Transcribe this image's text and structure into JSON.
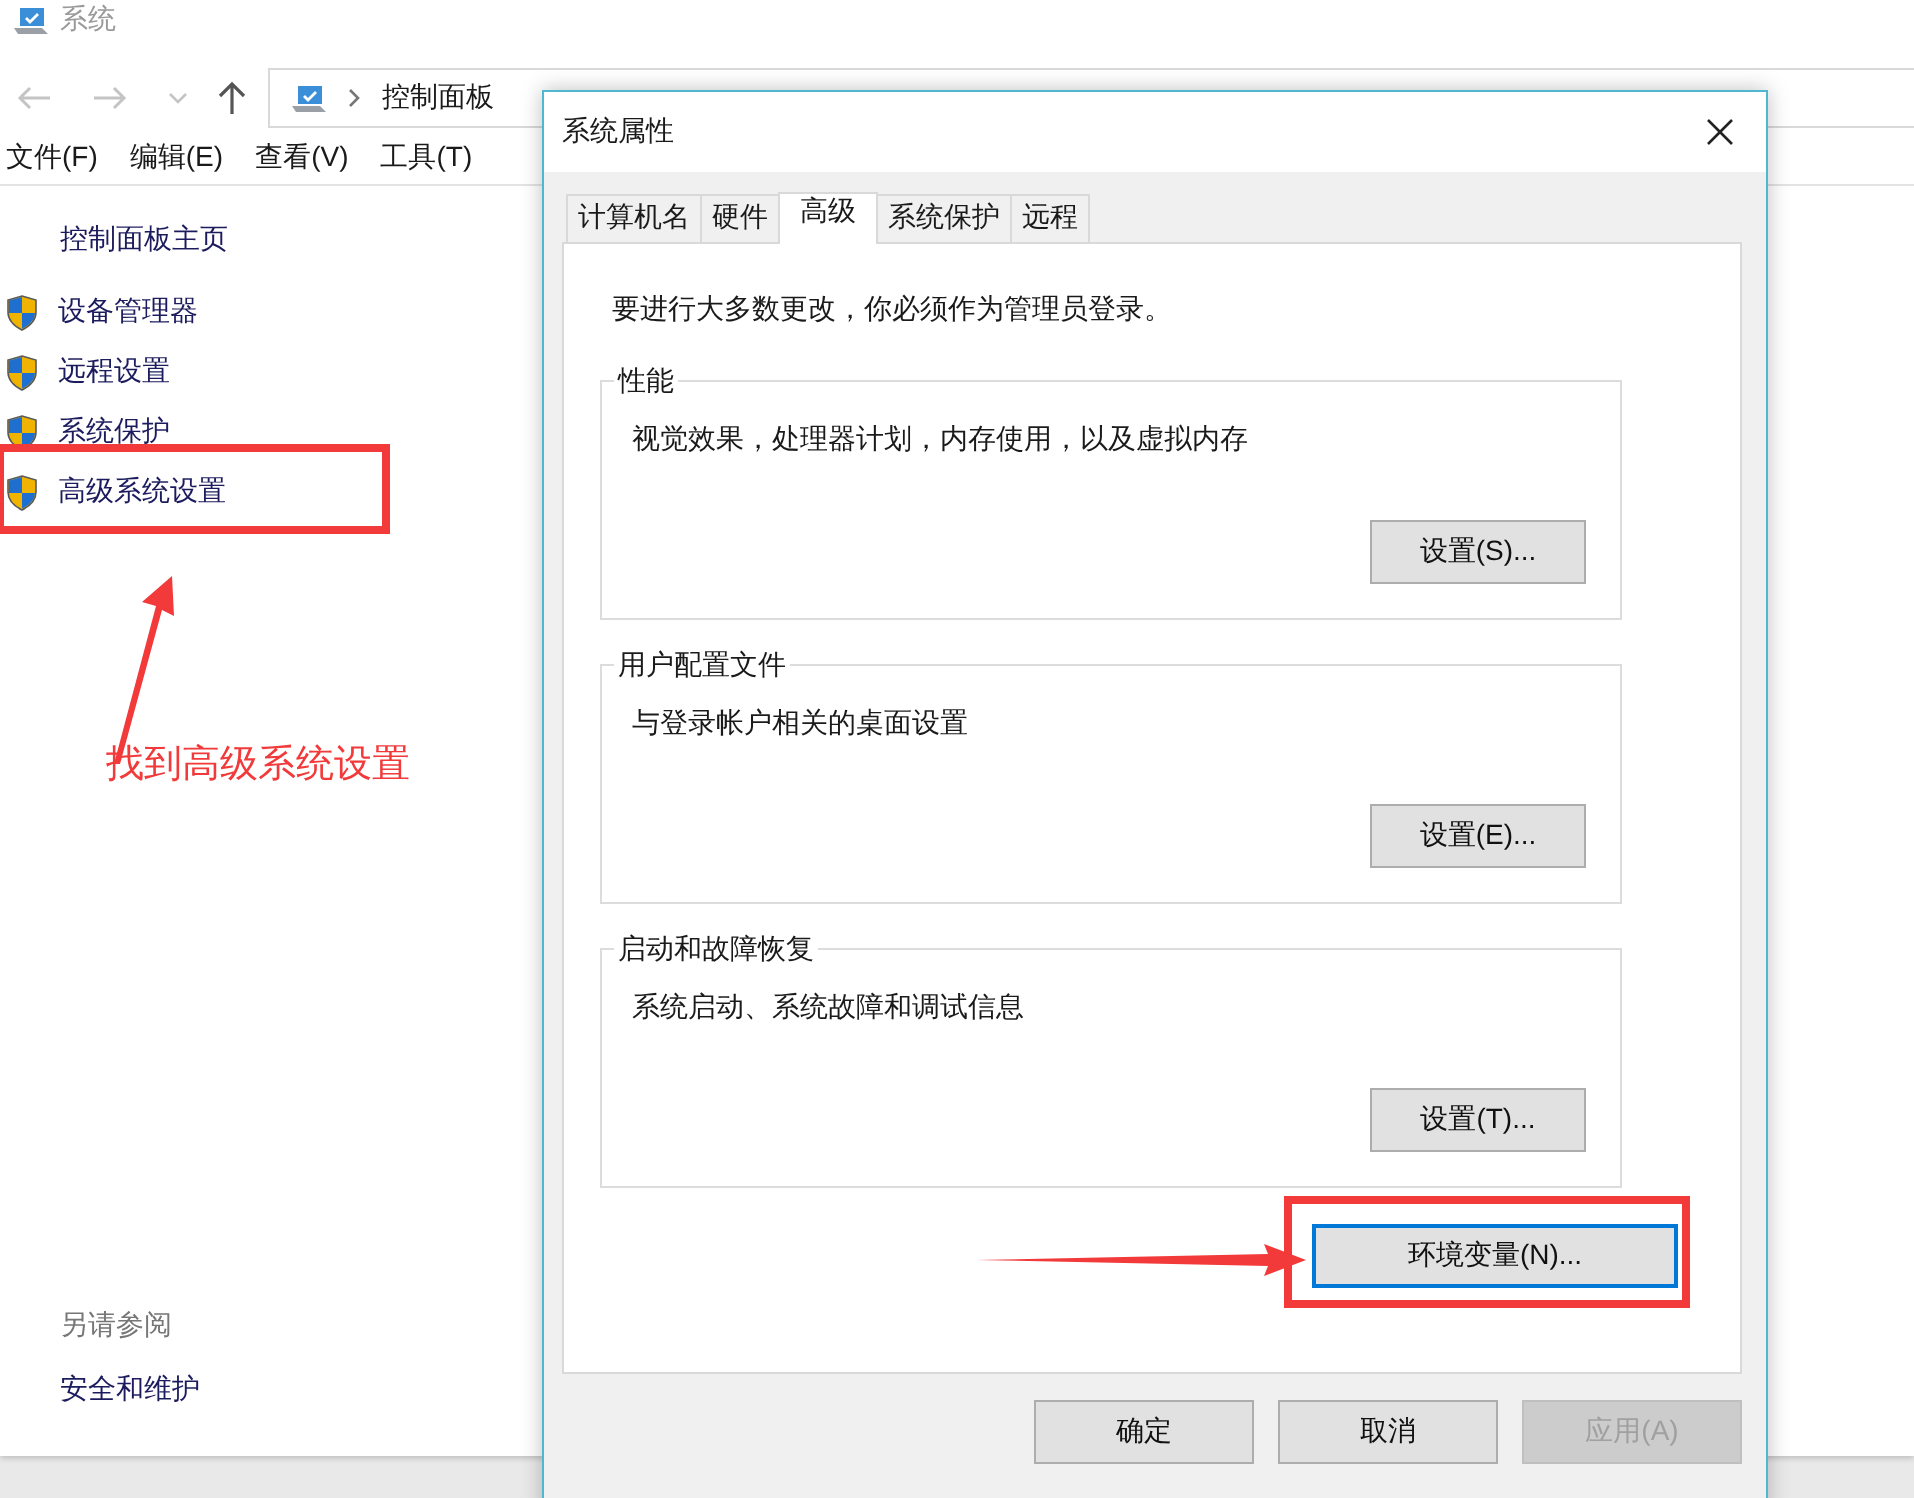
{
  "explorer": {
    "title": "系统",
    "breadcrumb": [
      "控制面板"
    ],
    "menu": [
      "文件(F)",
      "编辑(E)",
      "查看(V)",
      "工具(T)"
    ],
    "sidebar": {
      "home": "控制面板主页",
      "links": [
        {
          "label": "设备管理器",
          "highlighted": false
        },
        {
          "label": "远程设置",
          "highlighted": false
        },
        {
          "label": "系统保护",
          "highlighted": false
        },
        {
          "label": "高级系统设置",
          "highlighted": true
        }
      ],
      "see_also_heading": "另请参阅",
      "see_also": [
        "安全和维护"
      ]
    }
  },
  "dialog": {
    "title": "系统属性",
    "tabs": [
      {
        "label": "计算机名",
        "selected": false
      },
      {
        "label": "硬件",
        "selected": false
      },
      {
        "label": "高级",
        "selected": true
      },
      {
        "label": "系统保护",
        "selected": false
      },
      {
        "label": "远程",
        "selected": false
      }
    ],
    "notice": "要进行大多数更改，你必须作为管理员登录。",
    "groups": [
      {
        "title": "性能",
        "description": "视觉效果，处理器计划，内存使用，以及虚拟内存",
        "button": "设置(S)..."
      },
      {
        "title": "用户配置文件",
        "description": "与登录帐户相关的桌面设置",
        "button": "设置(E)..."
      },
      {
        "title": "启动和故障恢复",
        "description": "系统启动、系统故障和调试信息",
        "button": "设置(T)..."
      }
    ],
    "env_button": {
      "label": "环境变量(N)...",
      "focused": true,
      "highlighted": true
    },
    "buttons": [
      {
        "label": "确定",
        "disabled": false
      },
      {
        "label": "取消",
        "disabled": false
      },
      {
        "label": "应用(A)",
        "disabled": true
      }
    ]
  },
  "annotation": {
    "text": "找到高级系统设置"
  }
}
